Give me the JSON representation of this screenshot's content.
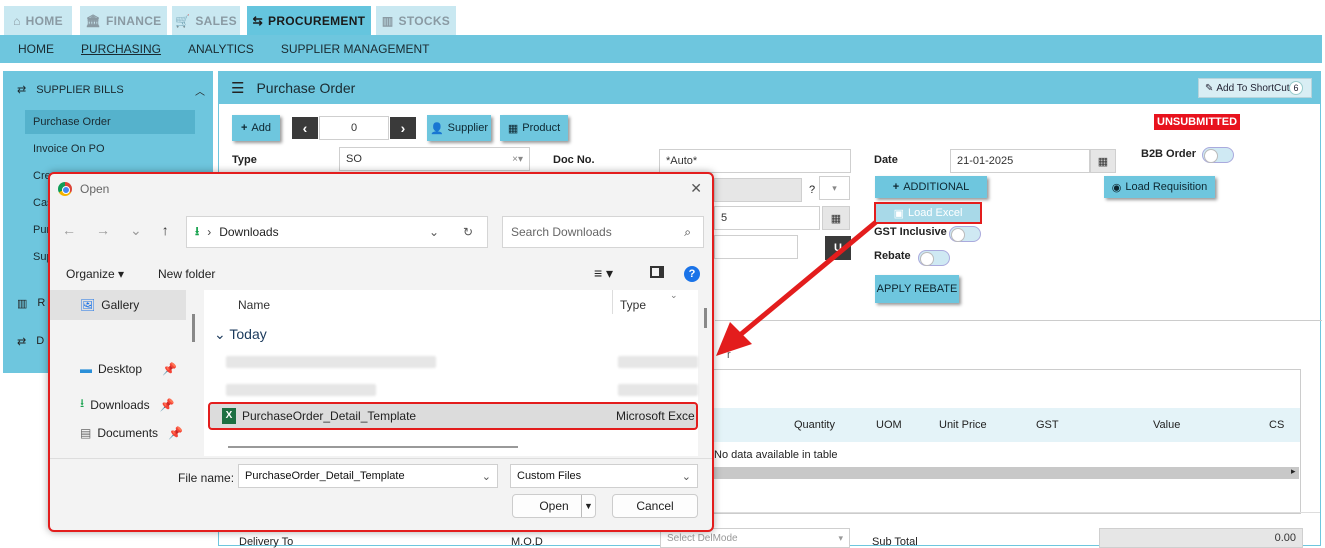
{
  "topnav": {
    "tabs": [
      {
        "label": "HOME",
        "icon": "home-icon"
      },
      {
        "label": "FINANCE",
        "icon": "bank-icon"
      },
      {
        "label": "SALES",
        "icon": "cart-icon"
      },
      {
        "label": "PROCUREMENT",
        "icon": "handshake-icon",
        "active": true
      },
      {
        "label": "STOCKS",
        "icon": "chart-icon"
      }
    ]
  },
  "subnav": {
    "items": [
      "HOME",
      "PURCHASING",
      "ANALYTICS",
      "SUPPLIER MANAGEMENT"
    ],
    "selected": "PURCHASING"
  },
  "sidebar": {
    "section": "SUPPLIER BILLS",
    "items": [
      "Purchase Order",
      "Invoice On PO",
      "Cre",
      "Cas",
      "Pur",
      "Sup"
    ],
    "selected": "Purchase Order",
    "other_sections": [
      "R",
      "D"
    ]
  },
  "main": {
    "title": "Purchase Order",
    "shortcut_label": "Add To ShortCut",
    "shortcut_count": "6",
    "toolbar": {
      "add": "Add",
      "counter": "0",
      "supplier": "Supplier",
      "product": "Product"
    },
    "status": "UNSUBMITTED",
    "form": {
      "type_label": "Type",
      "type_value": "SO",
      "docno_label": "Doc No.",
      "docno_value": "*Auto*",
      "date_label": "Date",
      "date_value": "21-01-2025",
      "b2b_label": "B2B Order",
      "question": "?",
      "partial5": "5",
      "u_btn": "U"
    },
    "buttons": {
      "additional": "ADDITIONAL",
      "load_excel": "Load Excel",
      "load_requisition": "Load Requisition",
      "apply_rebate": "APPLY REBATE"
    },
    "labels": {
      "gst": "GST Inclusive",
      "rebate": "Rebate"
    },
    "table": {
      "headers": [
        "Quantity",
        "UOM",
        "Unit Price",
        "GST",
        "Value",
        "CS"
      ],
      "empty": "No data available in table",
      "r_fragment": "r"
    },
    "footer": {
      "delivery_to": "Delivery To",
      "mod": "M.O.D",
      "del_placeholder": "Select DelMode",
      "subtotal_label": "Sub Total",
      "subtotal_value": "0.00"
    }
  },
  "dialog": {
    "title": "Open",
    "path": "Downloads",
    "search_placeholder": "Search Downloads",
    "organize": "Organize",
    "new_folder": "New folder",
    "nav": [
      {
        "label": "Gallery",
        "icon": "gallery-icon"
      },
      {
        "label": "Desktop",
        "icon": "desktop-icon"
      },
      {
        "label": "Downloads",
        "icon": "download-icon"
      },
      {
        "label": "Documents",
        "icon": "documents-icon"
      }
    ],
    "columns": {
      "name": "Name",
      "type": "Type"
    },
    "group": "Today",
    "selected_file": {
      "name": "PurchaseOrder_Detail_Template",
      "type": "Microsoft Exce"
    },
    "filename_label": "File name:",
    "filename_value": "PurchaseOrder_Detail_Template",
    "filetype": "Custom Files",
    "open_label": "Open",
    "cancel_label": "Cancel"
  }
}
